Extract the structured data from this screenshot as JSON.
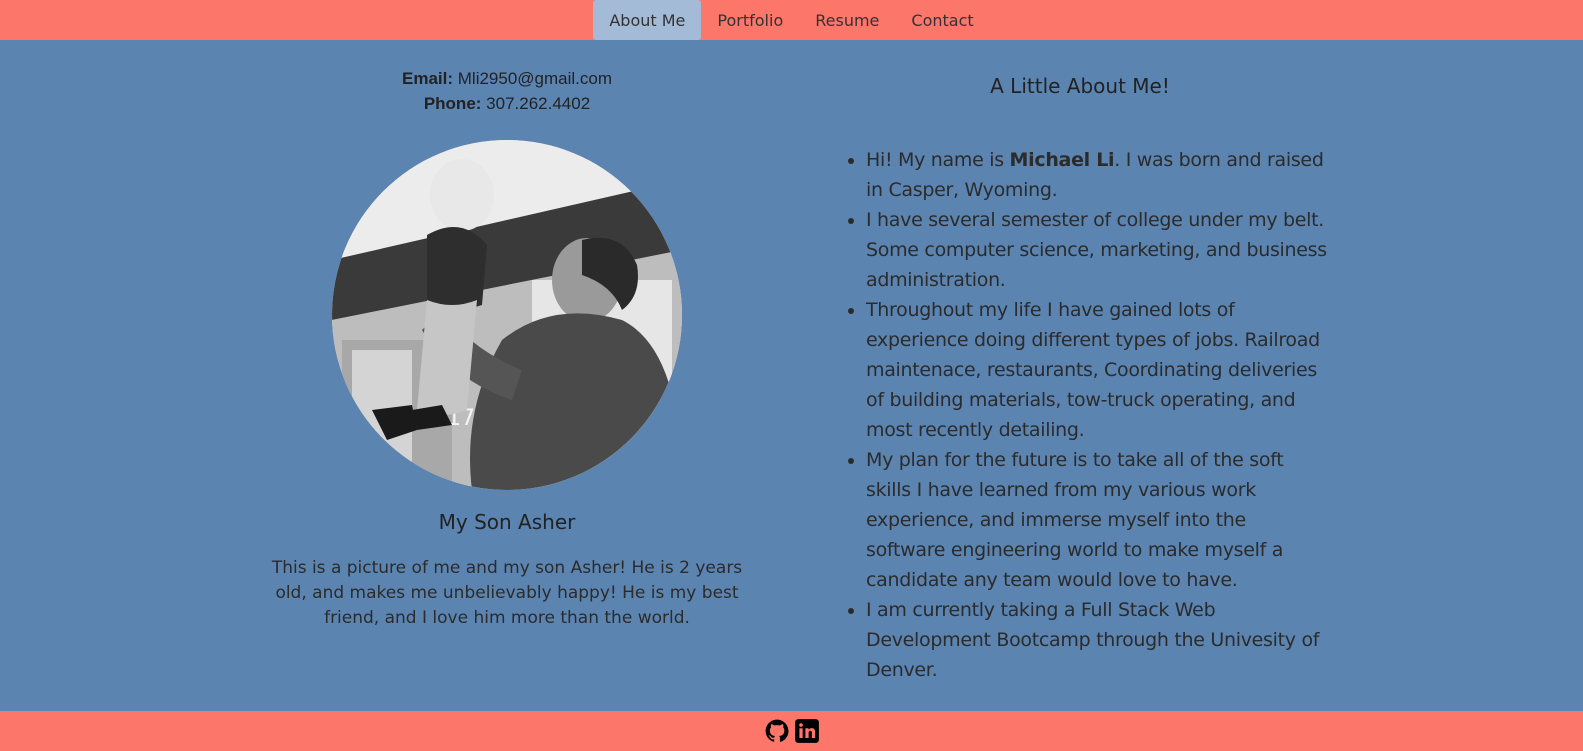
{
  "nav": {
    "items": [
      {
        "label": "About Me",
        "active": true
      },
      {
        "label": "Portfolio",
        "active": false
      },
      {
        "label": "Resume",
        "active": false
      },
      {
        "label": "Contact",
        "active": false
      }
    ]
  },
  "contact": {
    "email_label": "Email:",
    "email_value": "Mli2950@gmail.com",
    "phone_label": "Phone:",
    "phone_value": "307.262.4402"
  },
  "photo": {
    "alt": "Black and white photo of a man lifting his baby son"
  },
  "caption": {
    "title": "My Son Asher",
    "text": "This is a picture of me and my son Asher! He is 2 years old, and makes me unbelievably happy! He is my best friend, and I love him more than the world."
  },
  "about": {
    "title": "A Little About Me!",
    "bullets": [
      {
        "pre": "Hi! My name is ",
        "bold": "Michael Li",
        "post": ". I was born and raised in Casper, Wyoming."
      },
      {
        "pre": "I have several semester of college under my belt. Some computer science, marketing, and business administration.",
        "bold": "",
        "post": ""
      },
      {
        "pre": "Throughout my life I have gained lots of experience doing different types of jobs. Railroad maintenace, restaurants, Coordinating deliveries of building materials, tow-truck operating, and most recently detailing.",
        "bold": "",
        "post": ""
      },
      {
        "pre": "My plan for the future is to take all of the soft skills I have learned from my various work experience, and immerse myself into the software engineering world to make myself a candidate any team would love to have.",
        "bold": "",
        "post": ""
      },
      {
        "pre": "I am currently taking a Full Stack Web Development Bootcamp through the Univesity of Denver.",
        "bold": "",
        "post": ""
      }
    ]
  },
  "footer": {
    "icons": [
      "github-icon",
      "linkedin-icon"
    ]
  },
  "colors": {
    "header_bg": "#fc766a",
    "page_bg": "#5b84b1",
    "active_tab": "#a3bbd6"
  }
}
